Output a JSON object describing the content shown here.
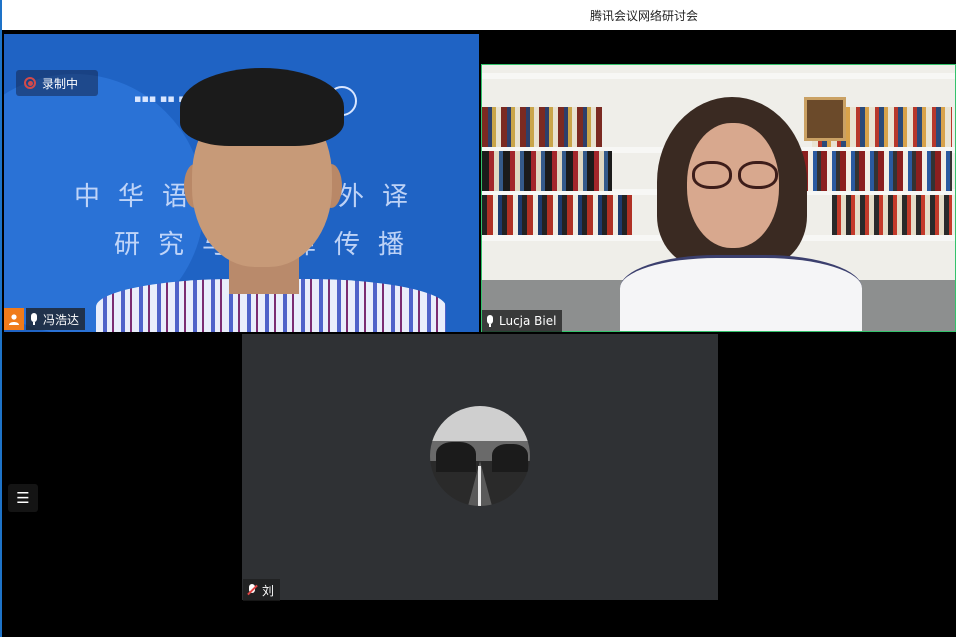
{
  "window": {
    "title": "腾讯会议网络研讨会"
  },
  "recording": {
    "label": "录制中",
    "color": "#d24a4a"
  },
  "participants": [
    {
      "name": "冯浩达",
      "tile_bg": "#1f63c4",
      "badge_color": "#f07b1a",
      "mic": "on"
    },
    {
      "name": "Lucja Biel",
      "active_speaker_border": "#33c26b",
      "mic": "on"
    },
    {
      "name": "刘",
      "tile_bg": "#2f3134",
      "mic": "muted"
    }
  ],
  "background_text": {
    "line1": "中华语言文化外译",
    "line2": "研究与翻译传播"
  },
  "icons": {
    "record": "record-icon",
    "mic": "microphone-icon",
    "mic_muted": "microphone-muted-icon",
    "host": "person-icon",
    "menu": "list-menu-icon"
  }
}
